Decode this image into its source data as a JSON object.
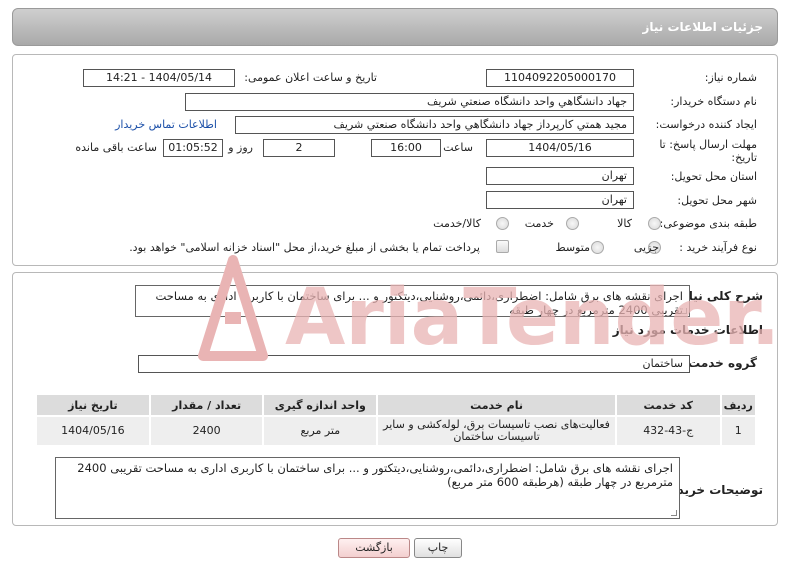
{
  "header": {
    "title": "جزئیات اطلاعات نیاز"
  },
  "fields": {
    "need_number_label": "شماره نیاز:",
    "need_number": "1104092205000170",
    "announce_label": "تاریخ و ساعت اعلان عمومی:",
    "announce_value": "1404/05/14 - 14:21",
    "buyer_org_label": "نام دستگاه خریدار:",
    "buyer_org": "جهاد دانشگاهي واحد دانشگاه صنعتي شريف",
    "creator_label": "ایجاد کننده درخواست:",
    "creator": "مجيد همتي كارپرداز جهاد دانشگاهي واحد دانشگاه صنعتي شريف",
    "contact_link": "اطلاعات تماس خریدار",
    "deadline_label": "مهلت ارسال پاسخ: تا تاریخ:",
    "deadline_date": "1404/05/16",
    "time_label": "ساعت",
    "deadline_time": "16:00",
    "days": "2",
    "days_label": "روز و",
    "remaining_time": "01:05:52",
    "remaining_label": "ساعت باقی مانده",
    "province_label": "استان محل تحویل:",
    "province": "تهران",
    "city_label": "شهر محل تحویل:",
    "city": "تهران",
    "category_label": "طبقه بندی موضوعی:",
    "category_options": [
      "کالا",
      "خدمت",
      "کالا/خدمت"
    ],
    "process_label": "نوع فرآیند خرید :",
    "process_options": [
      "جزیی",
      "متوسط"
    ],
    "payment_note": "پرداخت تمام یا بخشی از مبلغ خرید،از محل \"اسناد خزانه اسلامی\" خواهد بود."
  },
  "summary": {
    "label": "شرح کلی نیاز:",
    "text": "اجرای نقشه های برق شامل: اضطراری،دائمی،روشنایی،دیتکتور و ... برای ساختمان با کاربری اداری به مساحت تقریبی 2400 مترمربع در چهار طبقه"
  },
  "services": {
    "section_title": "اطلاعات خدمات مورد نیاز",
    "group_label": "گروه خدمت:",
    "group_value": "ساختمان",
    "columns": [
      "ردیف",
      "کد خدمت",
      "نام خدمت",
      "واحد اندازه گیری",
      "تعداد / مقدار",
      "تاریخ نیاز"
    ],
    "rows": [
      [
        "1",
        "ج-43-432",
        "فعالیت‌های نصب تاسیسات برق، لوله‌کشی و سایر تاسیسات ساختمان",
        "متر مربع",
        "2400",
        "1404/05/16"
      ]
    ]
  },
  "buyer_notes": {
    "label": "توضیحات خریدار:",
    "text": "اجرای نقشه های برق شامل: اضطراری،دائمی،روشنایی،دیتکتور و ... برای ساختمان با کاربری اداری به مساحت تقریبی 2400 مترمربع در چهار طبقه (هرطبقه 600 متر مربع)"
  },
  "buttons": {
    "print": "چاپ",
    "back": "بازگشت"
  },
  "watermark": "AriaTender.net",
  "colors": {
    "link": "#1b4fa8",
    "watermark": "#e9b4b4"
  }
}
